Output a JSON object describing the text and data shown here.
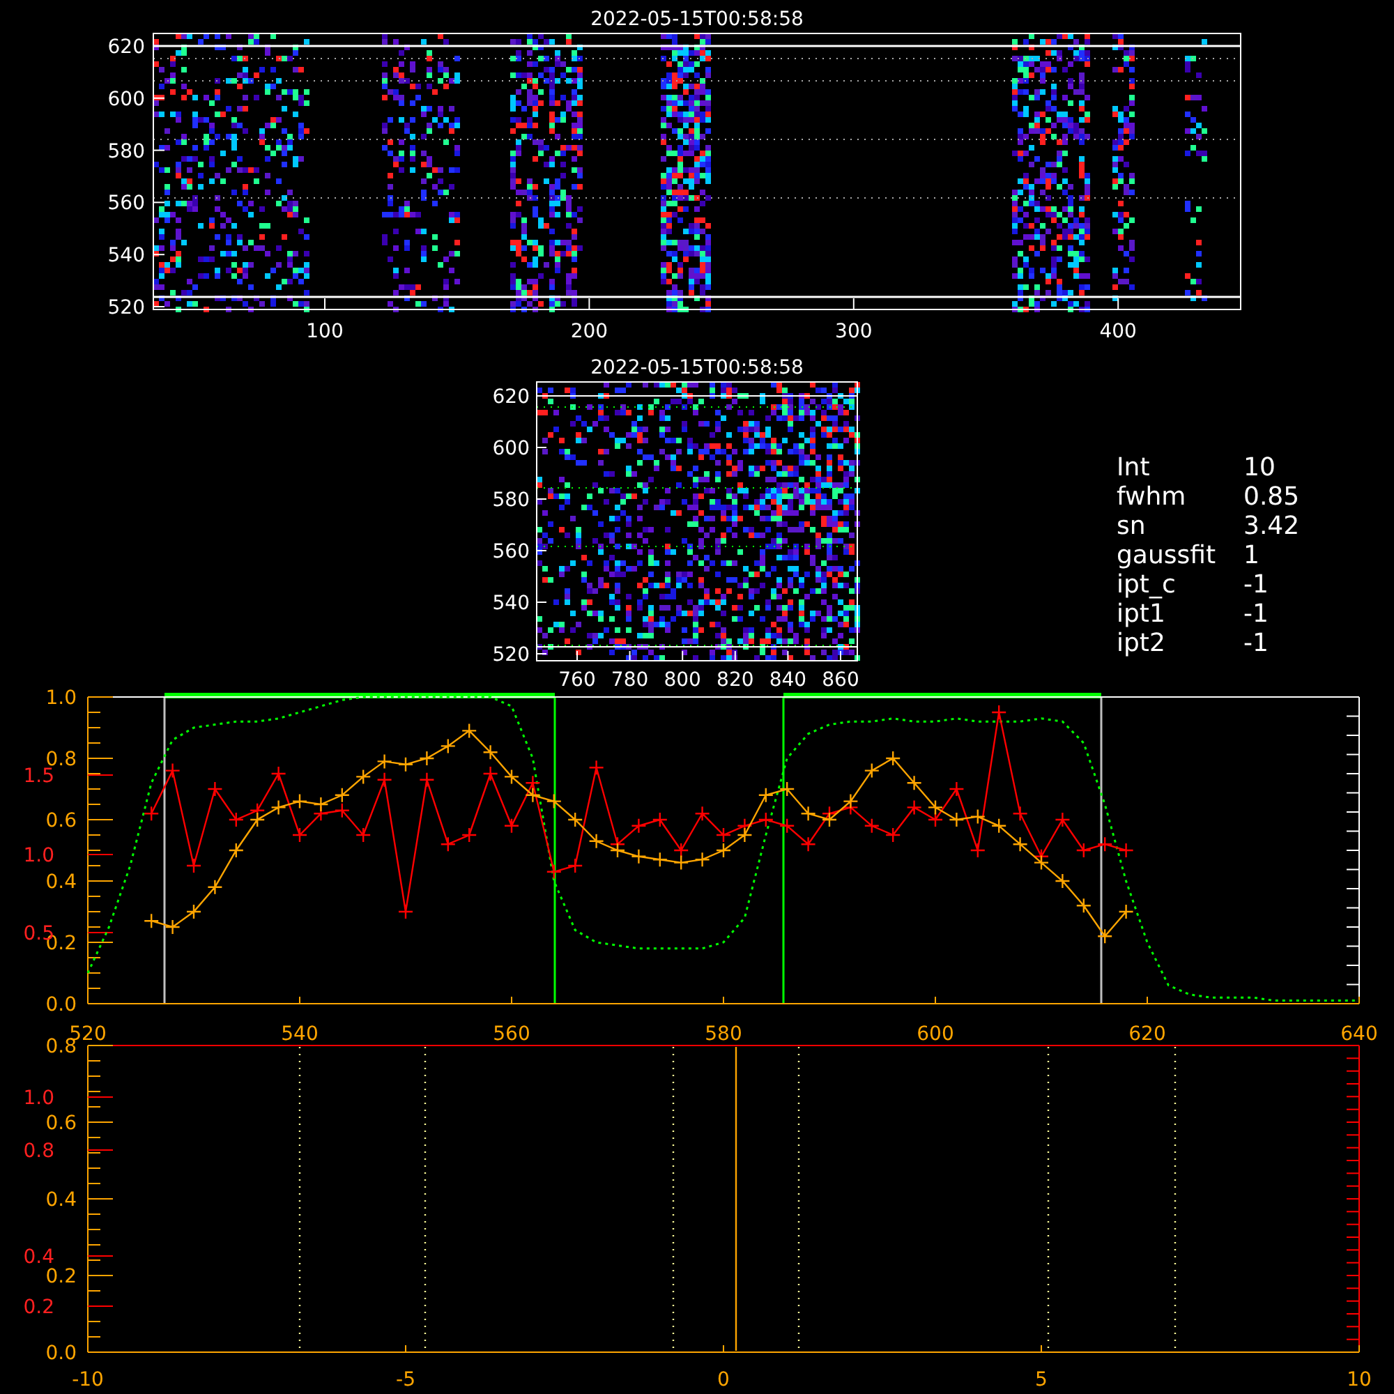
{
  "image_top": {
    "title": "2022-05-15T00:58:58",
    "xticks": [
      "100",
      "200",
      "300",
      "400"
    ],
    "yticks": [
      "620",
      "600",
      "580",
      "560",
      "540",
      "520"
    ]
  },
  "image_zoom": {
    "title": "2022-05-15T00:58:58",
    "xticks": [
      "760",
      "780",
      "800",
      "820",
      "840",
      "860"
    ],
    "yticks": [
      "620",
      "600",
      "580",
      "560",
      "540",
      "520"
    ]
  },
  "fit_info": [
    {
      "label": "Int",
      "value": "10"
    },
    {
      "label": "fwhm",
      "value": "0.85"
    },
    {
      "label": "sn",
      "value": "3.42"
    },
    {
      "label": "gaussfit",
      "value": "1"
    },
    {
      "label": "ipt_c",
      "value": "-1"
    },
    {
      "label": "ipt1",
      "value": "-1"
    },
    {
      "label": "ipt2",
      "value": "-1"
    }
  ],
  "line_plot": {
    "red_axis_ticks": [
      "1.5",
      "1.0",
      "0.5"
    ],
    "chart_data": {
      "type": "line",
      "xlim": [
        520,
        640
      ],
      "ylim": [
        0,
        1
      ],
      "xticks": [
        520,
        540,
        560,
        580,
        600,
        620,
        640
      ],
      "yticks": [
        {
          "value": 0,
          "label": "0.0"
        },
        {
          "value": 0.2,
          "label": "0.2"
        },
        {
          "value": 0.4,
          "label": "0.4"
        },
        {
          "value": 0.6,
          "label": "0.6"
        },
        {
          "value": 0.8,
          "label": "0.8"
        },
        {
          "value": 1,
          "label": "1.0"
        }
      ],
      "x": [
        520,
        522,
        524,
        526,
        528,
        530,
        532,
        534,
        536,
        538,
        540,
        542,
        544,
        546,
        548,
        550,
        552,
        554,
        556,
        558,
        560,
        562,
        564,
        566,
        568,
        570,
        572,
        574,
        576,
        578,
        580,
        582,
        584,
        586,
        588,
        590,
        592,
        594,
        596,
        598,
        600,
        602,
        604,
        606,
        608,
        610,
        612,
        614,
        616,
        618,
        620,
        622,
        624,
        626,
        628,
        630,
        632,
        634,
        636,
        638,
        640
      ],
      "series": [
        {
          "color": "#00ff00",
          "line_style": "dotted",
          "values": [
            0.1,
            0.25,
            0.45,
            0.72,
            0.86,
            0.9,
            0.91,
            0.92,
            0.92,
            0.93,
            0.95,
            0.97,
            0.99,
            1.0,
            1.0,
            1.0,
            1.0,
            1.0,
            1.0,
            1.0,
            0.97,
            0.8,
            0.4,
            0.24,
            0.2,
            0.19,
            0.18,
            0.18,
            0.18,
            0.18,
            0.2,
            0.28,
            0.55,
            0.8,
            0.88,
            0.91,
            0.92,
            0.92,
            0.93,
            0.92,
            0.92,
            0.93,
            0.92,
            0.92,
            0.92,
            0.93,
            0.92,
            0.85,
            0.65,
            0.4,
            0.2,
            0.06,
            0.03,
            0.02,
            0.02,
            0.02,
            0.01,
            0.01,
            0.01,
            0.01,
            0.01
          ]
        },
        {
          "color": "#ff0000",
          "marker": "+",
          "values": [
            null,
            null,
            null,
            0.62,
            0.76,
            0.45,
            0.7,
            0.6,
            0.63,
            0.75,
            0.55,
            0.62,
            0.63,
            0.55,
            0.73,
            0.3,
            0.73,
            0.52,
            0.55,
            0.75,
            0.58,
            0.72,
            0.43,
            0.45,
            0.77,
            0.52,
            0.58,
            0.6,
            0.5,
            0.62,
            0.55,
            0.58,
            0.6,
            0.58,
            0.52,
            0.62,
            0.64,
            0.58,
            0.55,
            0.64,
            0.6,
            0.7,
            0.5,
            0.95,
            0.62,
            0.48,
            0.6,
            0.5,
            0.52,
            0.5,
            null,
            null,
            null,
            null,
            null,
            null,
            null,
            null,
            null,
            null,
            null
          ]
        },
        {
          "color": "#ffa500",
          "marker": "+",
          "values": [
            null,
            null,
            null,
            0.27,
            0.25,
            0.3,
            0.38,
            0.5,
            0.6,
            0.64,
            0.66,
            0.65,
            0.68,
            0.74,
            0.79,
            0.78,
            0.8,
            0.84,
            0.89,
            0.82,
            0.74,
            0.68,
            0.66,
            0.6,
            0.53,
            0.5,
            0.48,
            0.47,
            0.46,
            0.47,
            0.5,
            0.55,
            0.68,
            0.7,
            0.62,
            0.6,
            0.66,
            0.76,
            0.8,
            0.72,
            0.64,
            0.6,
            0.61,
            0.58,
            0.52,
            0.46,
            0.4,
            0.32,
            0.22,
            0.3,
            null,
            null,
            null,
            null,
            null,
            null,
            null,
            null,
            null,
            null,
            null
          ]
        }
      ]
    }
  },
  "bottom_plot": {
    "red_axis_ticks": [
      "1.0",
      "0.8",
      "0.4",
      "0.2"
    ],
    "chart_data": {
      "type": "line",
      "xlim": [
        -10,
        10
      ],
      "ylim": [
        0,
        0.8
      ],
      "xticks": [
        -10,
        -5,
        0,
        5,
        10
      ],
      "yticks": [
        {
          "value": 0,
          "label": "0.0"
        },
        {
          "value": 0.2,
          "label": "0.2"
        },
        {
          "value": 0.4,
          "label": "0.4"
        },
        {
          "value": 0.6,
          "label": "0.6"
        },
        {
          "value": 0.8,
          "label": "0.8"
        }
      ]
    }
  }
}
